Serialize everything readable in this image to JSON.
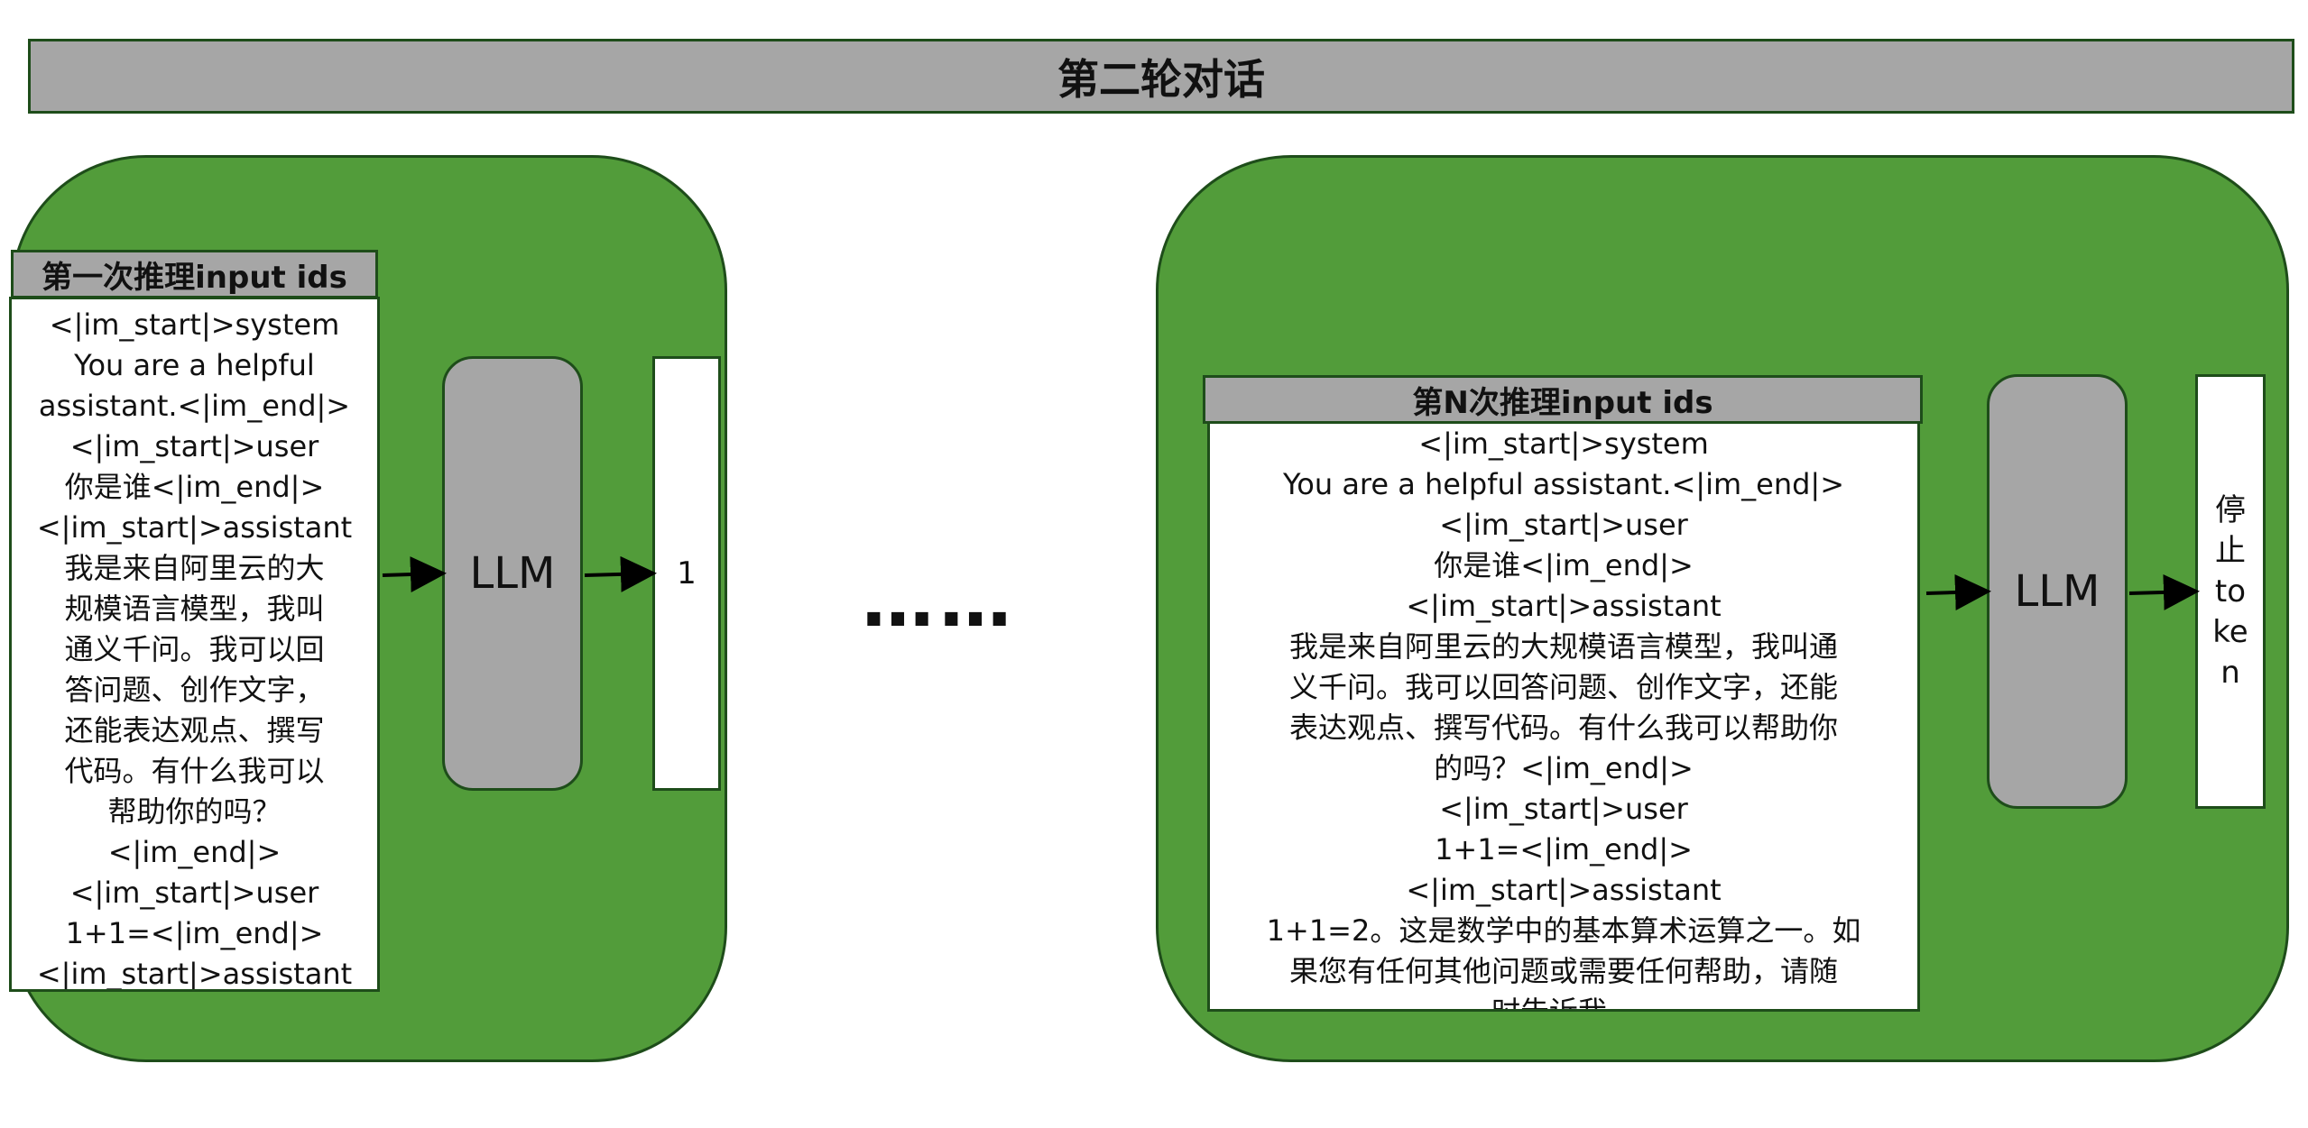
{
  "title": "第二轮对话",
  "left": {
    "header": "第一次推理input ids",
    "lines": [
      "<|im_start|>system",
      "You are a helpful",
      "assistant.<|im_end|>",
      "<|im_start|>user",
      "你是谁<|im_end|>",
      "<|im_start|>assistant",
      "我是来自阿里云的大",
      "规模语言模型，我叫",
      "通义千问。我可以回",
      "答问题、创作文字，",
      "还能表达观点、撰写",
      "代码。有什么我可以",
      "帮助你的吗？",
      "<|im_end|>",
      "<|im_start|>user",
      "1+1=<|im_end|>",
      "<|im_start|>assistant"
    ],
    "llm": "LLM",
    "output": "1"
  },
  "ellipsis": "……",
  "right": {
    "header": "第N次推理input ids",
    "lines": [
      "<|im_start|>system",
      "You are a helpful assistant.<|im_end|>",
      "<|im_start|>user",
      "你是谁<|im_end|>",
      "<|im_start|>assistant",
      "我是来自阿里云的大规模语言模型，我叫通",
      "义千问。我可以回答问题、创作文字，还能",
      "表达观点、撰写代码。有什么我可以帮助你",
      "的吗？<|im_end|>",
      "<|im_start|>user",
      "1+1=<|im_end|>",
      "<|im_start|>assistant",
      "1+1=2。这是数学中的基本算术运算之一。如",
      "果您有任何其他问题或需要任何帮助，请随",
      "时告诉我。"
    ],
    "llm": "LLM",
    "output": "停止token"
  },
  "colors": {
    "panel": "#529c3a",
    "border": "#1e4d1a",
    "grey": "#a6a6a6"
  }
}
